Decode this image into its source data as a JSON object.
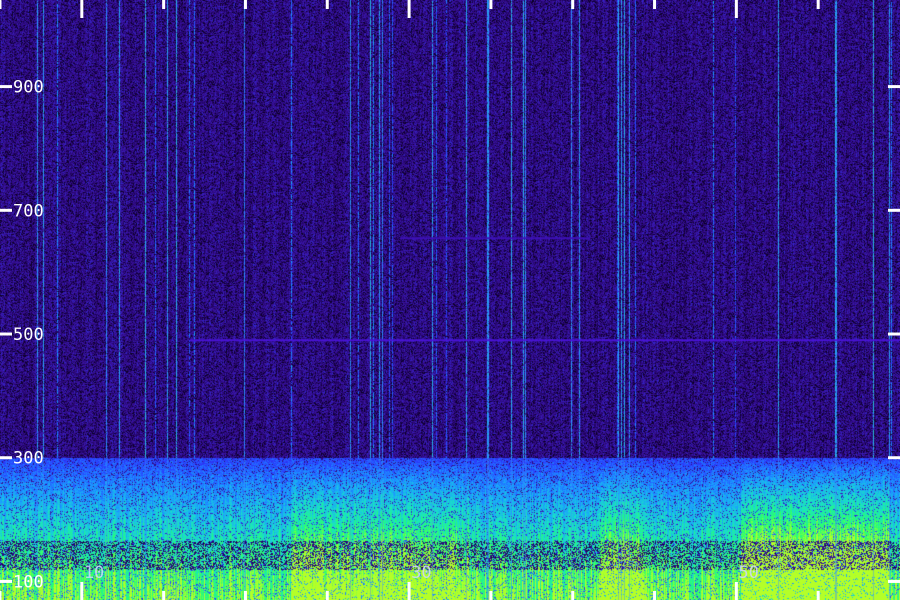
{
  "chart_data": {
    "type": "heatmap",
    "title": "",
    "xlabel": "",
    "ylabel": "",
    "x_tick_labels": [
      "10",
      "30",
      "50"
    ],
    "x_tick_values": [
      10,
      30,
      50
    ],
    "x_minor_tick_values": [
      5,
      15,
      20,
      25,
      35,
      40,
      45,
      55
    ],
    "xlim": [
      5,
      60
    ],
    "y_tick_labels": [
      "100",
      "300",
      "500",
      "700",
      "900"
    ],
    "y_tick_values": [
      100,
      300,
      500,
      700,
      900
    ],
    "ylim": [
      70,
      1040
    ],
    "colormap": [
      "#000000",
      "#1a0050",
      "#3a12a0",
      "#2a3cff",
      "#1aa0ff",
      "#19e0c8",
      "#28ff6e",
      "#b4ff28"
    ],
    "bands": [
      {
        "y_from": 70,
        "y_to": 300,
        "level": "high"
      },
      {
        "y_from": 300,
        "y_to": 1040,
        "level": "low"
      }
    ],
    "lines": [
      {
        "y": 490,
        "color": "#4a14d8"
      },
      {
        "y": 655,
        "color": "#3e10b8"
      }
    ]
  }
}
